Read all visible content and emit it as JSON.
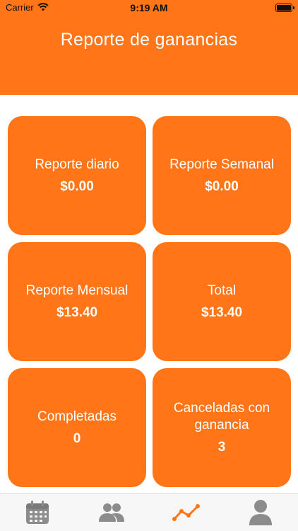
{
  "status_bar": {
    "carrier": "Carrier",
    "time": "9:19 AM"
  },
  "header": {
    "title": "Reporte de ganancias"
  },
  "cards": [
    {
      "title": "Reporte diario",
      "value": "$0.00"
    },
    {
      "title": "Reporte Semanal",
      "value": "$0.00"
    },
    {
      "title": "Reporte Mensual",
      "value": "$13.40"
    },
    {
      "title": "Total",
      "value": "$13.40"
    },
    {
      "title": "Completadas",
      "value": "0"
    },
    {
      "title": "Canceladas con ganancia",
      "value": "3"
    }
  ],
  "tab_bar": {
    "tabs": [
      {
        "icon": "calendar-icon",
        "selected": false
      },
      {
        "icon": "users-icon",
        "selected": false
      },
      {
        "icon": "chart-line-icon",
        "selected": true
      },
      {
        "icon": "profile-icon",
        "selected": false
      }
    ]
  },
  "colors": {
    "accent": "#ff7518",
    "tab_inactive": "#8c8c8c",
    "tab_active": "#ff7518"
  }
}
